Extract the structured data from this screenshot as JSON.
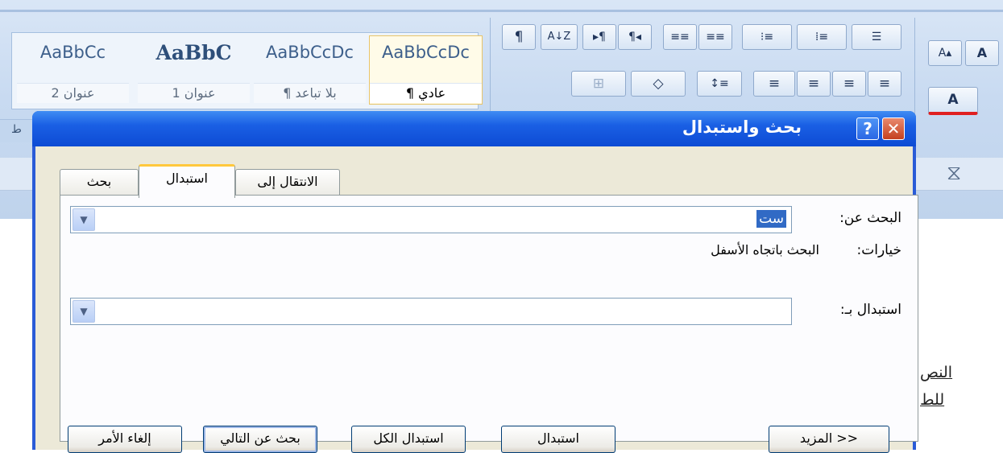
{
  "ribbon": {
    "styles": [
      {
        "preview": "AaBbCcDc",
        "label": "¶ عادي",
        "active": true
      },
      {
        "preview": "AaBbCcDc",
        "label": "¶ بلا تباعد"
      },
      {
        "preview": "AaBbC",
        "label": "عنوان 1"
      },
      {
        "preview": "AaBbCc",
        "label": "عنوان 2"
      }
    ],
    "group_label": "ط",
    "paragraph_buttons_row1": [
      "¶",
      "A↓Z",
      "▸¶",
      "¶◂",
      "≡≡",
      "≡≡",
      "⁝≡",
      "⁞≡",
      "☰"
    ],
    "paragraph_buttons_row2": [
      "⊞",
      "◇",
      "↕≡",
      "≡",
      "≡",
      "≡",
      "≡"
    ],
    "font_buttons": [
      "A▴",
      "A"
    ]
  },
  "document": {
    "text_fragments": [
      "النص",
      "للط"
    ]
  },
  "dialog": {
    "title": "بحث واستبدال",
    "help_glyph": "?",
    "close_glyph": "✕",
    "tabs": [
      {
        "label": "بحث"
      },
      {
        "label": "استبدال",
        "active": true
      },
      {
        "label": "الانتقال إلى"
      }
    ],
    "find_label": "البحث عن:",
    "find_value": "ست",
    "options_label": "خيارات:",
    "options_value": "البحث باتجاه الأسفل",
    "replace_label": "استبدال بـ:",
    "replace_value": "",
    "buttons": {
      "more": "المزيد >>",
      "replace": "استبدال",
      "replace_all": "استبدال الكل",
      "find_next": "بحث عن التالي",
      "cancel": "إلغاء الأمر"
    }
  }
}
